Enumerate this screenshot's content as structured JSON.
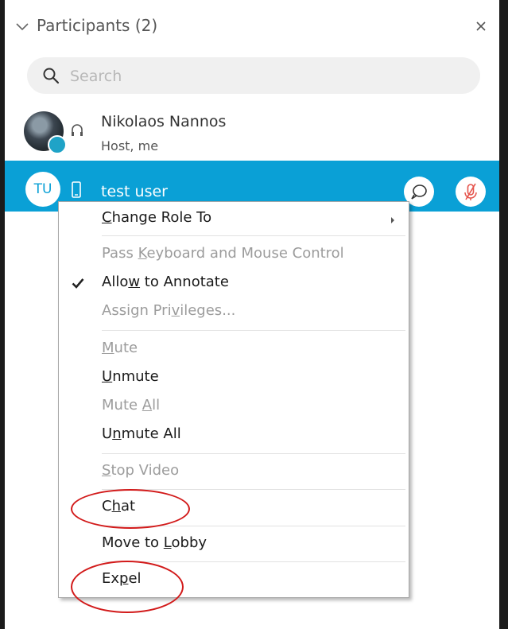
{
  "panel": {
    "title": "Participants (2)",
    "icons": {
      "collapse": "chevron-down-icon",
      "close": "close-icon"
    }
  },
  "search": {
    "placeholder": "Search",
    "value": "",
    "icon": "search-icon"
  },
  "participants": [
    {
      "name": "Nikolaos Nannos",
      "subtitle": "Host, me",
      "avatar": "photo",
      "icon": "headset-icon"
    },
    {
      "name": "test user",
      "initials": "TU",
      "icon": "mobile-device-icon",
      "selected": true,
      "actions": [
        "chat-icon",
        "muted-mic-icon"
      ]
    }
  ],
  "context_menu": {
    "items": [
      {
        "label": "Change Role To",
        "mnemonic": "C",
        "enabled": true,
        "submenu": true
      },
      {
        "label": "Pass Keyboard and Mouse Control",
        "mnemonic": "K",
        "enabled": false
      },
      {
        "label": "Allow to Annotate",
        "mnemonic": "w",
        "enabled": true,
        "checked": true
      },
      {
        "label": "Assign Privileges...",
        "mnemonic": "v",
        "enabled": false
      },
      {
        "label": "Mute",
        "mnemonic": "M",
        "enabled": false
      },
      {
        "label": "Unmute",
        "mnemonic": "U",
        "enabled": true
      },
      {
        "label": "Mute All",
        "mnemonic": "A",
        "enabled": false
      },
      {
        "label": "Unmute All",
        "mnemonic": "n",
        "enabled": true
      },
      {
        "label": "Stop Video",
        "mnemonic": "S",
        "enabled": false
      },
      {
        "label": "Chat",
        "mnemonic": "h",
        "enabled": true
      },
      {
        "label": "Move to Lobby",
        "mnemonic": "L",
        "enabled": true
      },
      {
        "label": "Expel",
        "mnemonic": "p",
        "enabled": true
      }
    ]
  },
  "colors": {
    "selection": "#0aa0d6",
    "annotation_circle": "#d21a1a",
    "status_badge": "#1fa3c7",
    "muted_mic": "#e5534b"
  }
}
